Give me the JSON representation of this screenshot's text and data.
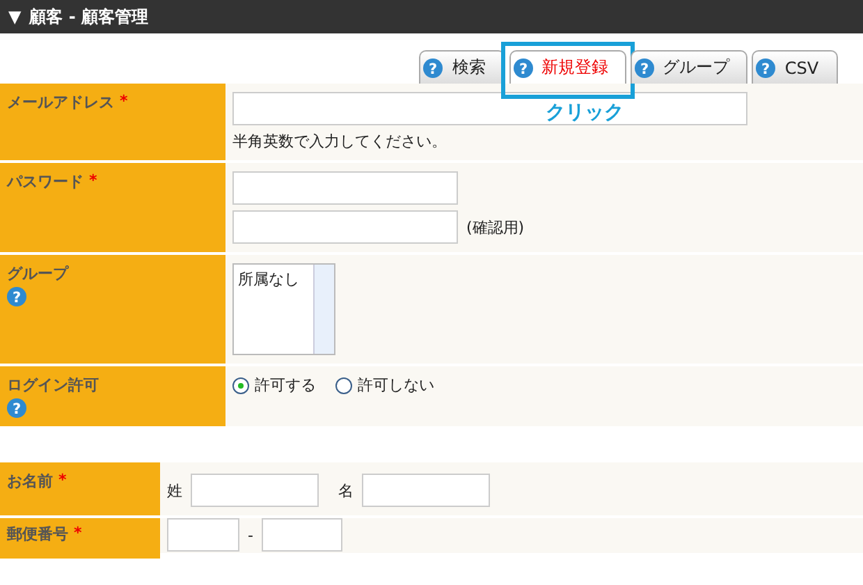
{
  "header": {
    "toggle": "▼",
    "title": "顧客 - 顧客管理"
  },
  "tabs": [
    {
      "label": "検索",
      "selected": false,
      "help": "?"
    },
    {
      "label": "新規登録",
      "selected": true,
      "help": "?"
    },
    {
      "label": "グループ",
      "selected": false,
      "help": "?"
    },
    {
      "label": "CSV",
      "selected": false,
      "help": "?"
    }
  ],
  "annotation": {
    "text": "クリック"
  },
  "sections": [
    {
      "rows": [
        {
          "kind": "input",
          "label": "メールアドレス",
          "required_mark": "*",
          "note": "半角英数で入力してください。"
        },
        {
          "kind": "password_pair",
          "label": "パスワード",
          "required_mark": "*",
          "suffix": "(確認用)"
        },
        {
          "kind": "listbox",
          "label": "グループ",
          "help": "?",
          "options": [
            "所属なし"
          ]
        },
        {
          "kind": "radio",
          "label": "ログイン許可",
          "help": "?",
          "options": [
            {
              "label": "許可する",
              "selected": true
            },
            {
              "label": "許可しない",
              "selected": false
            }
          ]
        }
      ]
    },
    {
      "rows": [
        {
          "kind": "name_pair",
          "label": "お名前",
          "required_mark": "*",
          "parts": [
            "姓",
            "名"
          ]
        },
        {
          "kind": "postal",
          "label": "郵便番号",
          "required_mark": "*",
          "separator": "-"
        }
      ]
    }
  ]
}
